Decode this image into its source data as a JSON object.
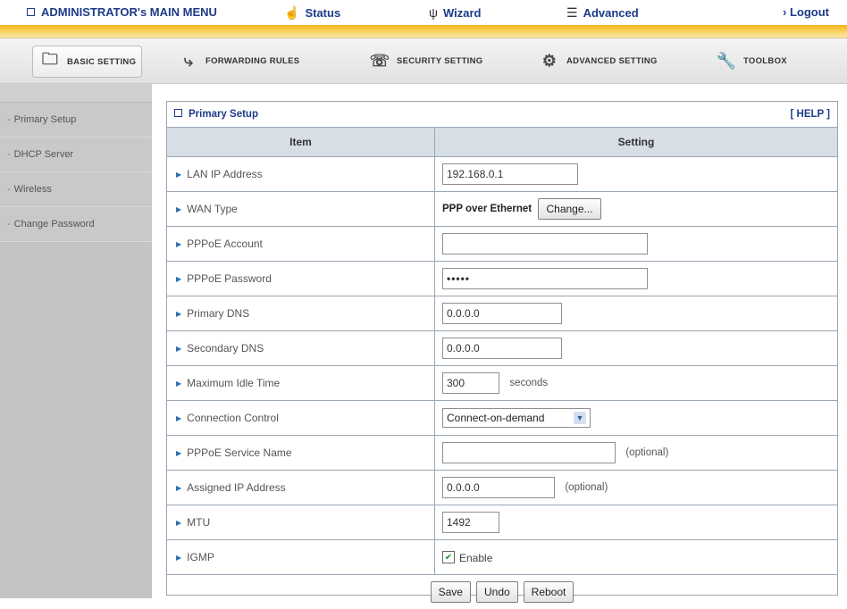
{
  "topbar": {
    "menu_title": "ADMINISTRATOR's MAIN MENU",
    "status_label": "Status",
    "wizard_label": "Wizard",
    "advanced_label": "Advanced",
    "logout_label": "› Logout"
  },
  "tabs": [
    {
      "label": "BASIC SETTING",
      "icon": "basic-setting-icon",
      "active": true
    },
    {
      "label": "FORWARDING RULES",
      "icon": "forwarding-icon",
      "active": false
    },
    {
      "label": "SECURITY SETTING",
      "icon": "security-icon",
      "active": false
    },
    {
      "label": "ADVANCED SETTING",
      "icon": "advanced-setting-icon",
      "active": false
    },
    {
      "label": "TOOLBOX",
      "icon": "toolbox-icon",
      "active": false
    }
  ],
  "sidebar": {
    "items": [
      {
        "label": "Primary Setup"
      },
      {
        "label": "DHCP Server"
      },
      {
        "label": "Wireless"
      },
      {
        "label": "Change Password"
      }
    ]
  },
  "panel": {
    "title": "Primary Setup",
    "help": "[ HELP ]",
    "col_item": "Item",
    "col_setting": "Setting"
  },
  "rows": {
    "lan_ip": {
      "label": "LAN IP Address",
      "value": "192.168.0.1"
    },
    "wan_type": {
      "label": "WAN Type",
      "value": "PPP over Ethernet",
      "button": "Change..."
    },
    "pppoe_account": {
      "label": "PPPoE Account",
      "value": ""
    },
    "pppoe_password": {
      "label": "PPPoE Password",
      "value": "•••••"
    },
    "primary_dns": {
      "label": "Primary DNS",
      "value": "0.0.0.0"
    },
    "secondary_dns": {
      "label": "Secondary DNS",
      "value": "0.0.0.0"
    },
    "max_idle": {
      "label": "Maximum Idle Time",
      "value": "300",
      "unit": "seconds"
    },
    "connection_control": {
      "label": "Connection Control",
      "value": "Connect-on-demand"
    },
    "service_name": {
      "label": "PPPoE Service Name",
      "value": "",
      "note": "(optional)"
    },
    "assigned_ip": {
      "label": "Assigned IP Address",
      "value": "0.0.0.0",
      "note": "(optional)"
    },
    "mtu": {
      "label": "MTU",
      "value": "1492"
    },
    "igmp": {
      "label": "IGMP",
      "value": "Enable",
      "checked": true
    }
  },
  "buttons": {
    "save": "Save",
    "undo": "Undo",
    "reboot": "Reboot"
  },
  "colors": {
    "accent": "#1d3a8a",
    "gold_bar": "#f3b51a",
    "sidebar_bg": "#c4c4c4",
    "header_row_bg": "#d7dee6"
  }
}
